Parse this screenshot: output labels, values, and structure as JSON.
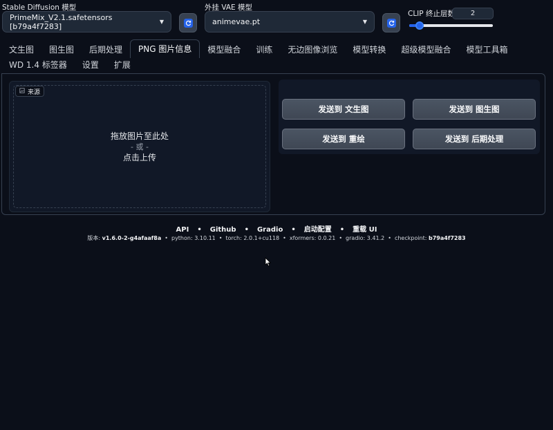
{
  "model": {
    "label": "Stable Diffusion 模型",
    "value": "PrimeMix_V2.1.safetensors [b79a4f7283]"
  },
  "vae": {
    "label": "外挂 VAE 模型",
    "value": "animevae.pt"
  },
  "clip": {
    "label": "CLIP 终止层数",
    "value": "2",
    "slider_min": 1,
    "slider_max": 12,
    "slider_value": 2
  },
  "tabs_row1": [
    "文生图",
    "图生图",
    "后期处理",
    "PNG 图片信息",
    "模型融合",
    "训练",
    "无边图像浏览",
    "模型转换",
    "超级模型融合",
    "模型工具箱"
  ],
  "tabs_row2": [
    "WD 1.4 标签器",
    "设置",
    "扩展"
  ],
  "active_tab": "PNG 图片信息",
  "upload": {
    "label": "来源",
    "line1": "拖放图片至此处",
    "line2": "- 或 -",
    "line3": "点击上传"
  },
  "buttons": {
    "txt2img": "发送到 文生图",
    "img2img": "发送到 图生图",
    "inpaint": "发送到 重绘",
    "extras": "发送到 后期处理"
  },
  "footer": {
    "links": [
      "API",
      "Github",
      "Gradio",
      "启动配置",
      "重载 UI"
    ],
    "version_label": "版本:",
    "version": "v1.6.0-2-g4afaaf8a",
    "python_label": "python:",
    "python": "3.10.11",
    "torch_label": "torch:",
    "torch": "2.0.1+cu118",
    "xformers_label": "xformers:",
    "xformers": "0.0.21",
    "gradio_label": "gradio:",
    "gradio": "3.41.2",
    "checkpoint_label": "checkpoint:",
    "checkpoint": "b79a4f7283"
  },
  "colors": {
    "background": "#0b0f19",
    "accent": "#2563eb",
    "button": "#4b5563"
  }
}
